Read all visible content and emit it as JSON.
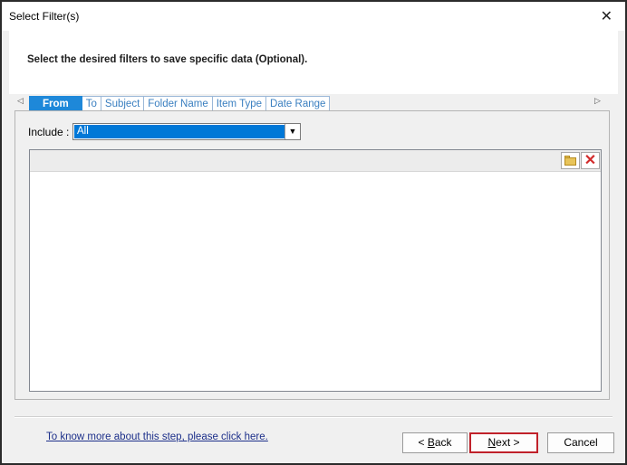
{
  "window": {
    "title": "Select Filter(s)",
    "close_glyph": "✕"
  },
  "header": {
    "instruction": "Select the desired filters to save specific data (Optional)."
  },
  "tabs": {
    "scroll_left": "◁",
    "scroll_right": "▷",
    "items": [
      {
        "label": "From",
        "active": true
      },
      {
        "label": "To",
        "active": false
      },
      {
        "label": "Subject",
        "active": false
      },
      {
        "label": "Folder Name",
        "active": false
      },
      {
        "label": "Item Type",
        "active": false
      },
      {
        "label": "Date Range",
        "active": false
      }
    ]
  },
  "filter": {
    "include_label": "Include :",
    "include_value": "All",
    "dropdown_glyph": "▼"
  },
  "list_toolbar": {
    "folder_icon": "folder-icon",
    "delete_icon": "delete-icon",
    "delete_glyph": "✕"
  },
  "footer": {
    "help_link": "To know more about this step, please click here.",
    "back_prefix": "< ",
    "back_mnemonic": "B",
    "back_rest": "ack",
    "next_mnemonic": "N",
    "next_rest": "ext >",
    "cancel_label": "Cancel"
  },
  "colors": {
    "active_tab": "#1e88d9",
    "tab_text": "#3a7fc0",
    "selection": "#0078d7",
    "next_highlight": "#c0212a",
    "link": "#1c2f8a"
  }
}
